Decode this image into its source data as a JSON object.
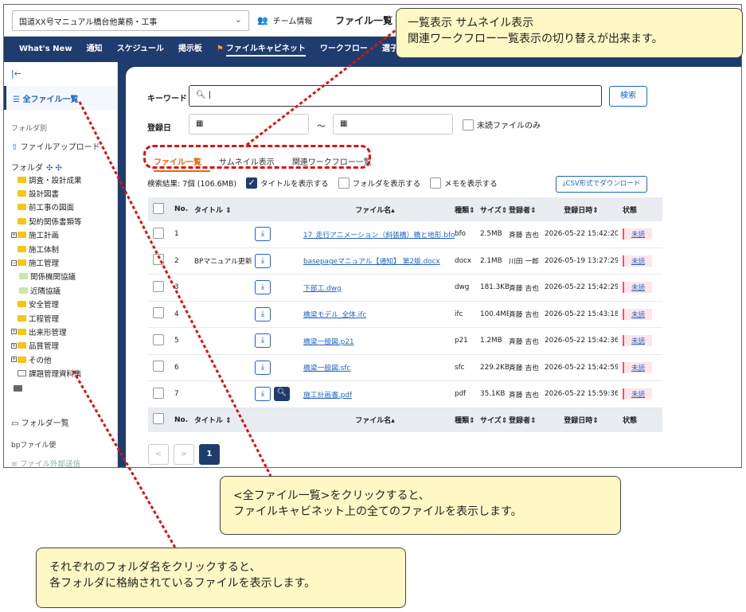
{
  "header": {
    "project": "国道XX号マニュアル橋台他業務・工事",
    "team_info": "チーム情報",
    "page_title": "ファイル一覧"
  },
  "nav": {
    "items": [
      "What's New",
      "通知",
      "スケジュール",
      "掲示板",
      "ファイルキャビネット",
      "ワークフロー",
      "選子"
    ]
  },
  "sidebar": {
    "collapse_icon": "collapse-left-icon",
    "all_files": "全ファイル一覧",
    "by_folder": "フォルダ別",
    "upload": "ファイルアップロード",
    "folder_label": "フォルダ",
    "tree": [
      {
        "label": "調査・設計成果",
        "level": 1,
        "expander": ""
      },
      {
        "label": "設計図書",
        "level": 1,
        "expander": ""
      },
      {
        "label": "前工事の図面",
        "level": 1,
        "expander": ""
      },
      {
        "label": "契約関係書類等",
        "level": 1,
        "expander": ""
      },
      {
        "label": "施工計画",
        "level": 1,
        "expander": "+"
      },
      {
        "label": "施工体制",
        "level": 1,
        "expander": ""
      },
      {
        "label": "施工管理",
        "level": 1,
        "expander": "−"
      },
      {
        "label": "関係機関協議",
        "level": 2,
        "expander": ""
      },
      {
        "label": "近隣協議",
        "level": 2,
        "expander": ""
      },
      {
        "label": "安全管理",
        "level": 1,
        "expander": ""
      },
      {
        "label": "工程管理",
        "level": 1,
        "expander": ""
      },
      {
        "label": "出来形管理",
        "level": 1,
        "expander": "+"
      },
      {
        "label": "品質管理",
        "level": 1,
        "expander": "+"
      },
      {
        "label": "その他",
        "level": 1,
        "expander": "+"
      },
      {
        "label": "課題管理資料集",
        "level": 1,
        "expander": ""
      }
    ],
    "folder_list": "フォルダ一覧",
    "bp_label": "bpファイル便",
    "external_send": "ファイル外部送信"
  },
  "search": {
    "keyword_label": "キーワード",
    "keyword_value": "",
    "search_button": "検索",
    "date_label": "登録日",
    "date_sep": "〜",
    "unread_only": "未読ファイルのみ"
  },
  "tabs": [
    "ファイル一覧",
    "サムネイル表示",
    "関連ワークフロー一覧"
  ],
  "results": {
    "summary": "検索結果: 7個 (106.6MB)",
    "show_title": "タイトルを表示する",
    "show_folder": "フォルダを表示する",
    "show_memo": "メモを表示する",
    "csv_button": "CSV形式でダウンロード"
  },
  "table": {
    "headers": {
      "no": "No.",
      "title": "タイトル",
      "file": "ファイル名",
      "type": "種類",
      "size": "サイズ",
      "user": "登録者",
      "date": "登録日時",
      "status": "状態"
    },
    "rows": [
      {
        "no": "1",
        "title": "",
        "file": "17_走行アニメーション（斜張橋）橋と地形.bfo",
        "type": "bfo",
        "size": "2.5MB",
        "user": "斉藤 吉也",
        "date": "2026-05-22 15:42:20",
        "status": "未読",
        "preview": false
      },
      {
        "no": "2",
        "title": "BPマニュアル更新",
        "file": "basepageマニュアル【通知】 第2版.docx",
        "type": "docx",
        "size": "2.1MB",
        "user": "川田 一郎",
        "date": "2026-05-19 13:27:29",
        "status": "未読",
        "preview": false
      },
      {
        "no": "3",
        "title": "",
        "file": "下部工.dwg",
        "type": "dwg",
        "size": "181.3KB",
        "user": "斉藤 吉也",
        "date": "2026-05-22 15:42:29",
        "status": "未読",
        "preview": false
      },
      {
        "no": "4",
        "title": "",
        "file": "橋梁モデル_全体.ifc",
        "type": "ifc",
        "size": "100.4MB",
        "user": "斉藤 吉也",
        "date": "2026-05-22 15:43:18",
        "status": "未読",
        "preview": false
      },
      {
        "no": "5",
        "title": "",
        "file": "橋梁一般図.p21",
        "type": "p21",
        "size": "1.2MB",
        "user": "斉藤 吉也",
        "date": "2026-05-22 15:42:36",
        "status": "未読",
        "preview": false
      },
      {
        "no": "6",
        "title": "",
        "file": "橋梁一般図.sfc",
        "type": "sfc",
        "size": "229.2KB",
        "user": "斉藤 吉也",
        "date": "2026-05-22 15:42:59",
        "status": "未読",
        "preview": false
      },
      {
        "no": "7",
        "title": "",
        "file": "施工計画書.pdf",
        "type": "pdf",
        "size": "35.1KB",
        "user": "斉藤 吉也",
        "date": "2026-05-22 15:59:36",
        "status": "未読",
        "preview": true
      }
    ]
  },
  "pager": {
    "prev": "<",
    "next": ">",
    "current": "1"
  },
  "callouts": {
    "top_line1": "一覧表示 サムネイル表示",
    "top_line2": "関連ワークフロー一覧表示の切り替えが出来ます。",
    "middle_line1": "<全ファイル一覧>をクリックすると、",
    "middle_line2": "ファイルキャビネット上の全てのファイルを表示します。",
    "bottom_line1": "それぞれのフォルダ名をクリックすると、",
    "bottom_line2": "各フォルダに格納されているファイルを表示します。"
  },
  "colors": {
    "nav": "#1f3c6e",
    "accent": "#e06a10",
    "link": "#1f63c5",
    "callout": "#fff8c4",
    "dash": "#dd1111"
  }
}
